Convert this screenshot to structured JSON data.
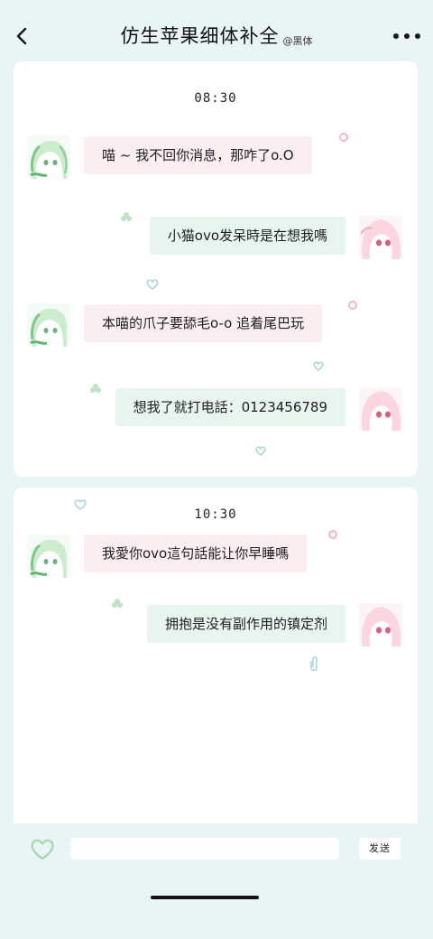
{
  "header": {
    "title": "仿生苹果细体补全",
    "subtitle": "@黑体"
  },
  "panels": [
    {
      "time": "08:30",
      "messages": [
        {
          "side": "left",
          "text": "喵 ~ 我不回你消息，那咋了o.O"
        },
        {
          "side": "right",
          "text": "小猫ovo发呆時是在想我嗎"
        },
        {
          "side": "left",
          "text": "本喵的爪子要舔毛o-o 追着尾巴玩"
        },
        {
          "side": "right",
          "text": "想我了就打电話：0123456789"
        }
      ]
    },
    {
      "time": "10:30",
      "messages": [
        {
          "side": "left",
          "text": "我愛你ovo這句話能让你早睡嗎"
        },
        {
          "side": "right",
          "text": "拥抱是没有副作用的镇定剂"
        }
      ]
    }
  ],
  "input": {
    "placeholder": "",
    "value": "",
    "send_label": "发送"
  },
  "icons": {
    "back": "chevron-left-icon",
    "more": "more-dots-icon",
    "heart": "heart-outline-icon"
  },
  "colors": {
    "background": "#e9f4f4",
    "left_bubble": "#fbeef1",
    "right_bubble": "#e8f4ee",
    "heart": "#a8d8b4"
  }
}
